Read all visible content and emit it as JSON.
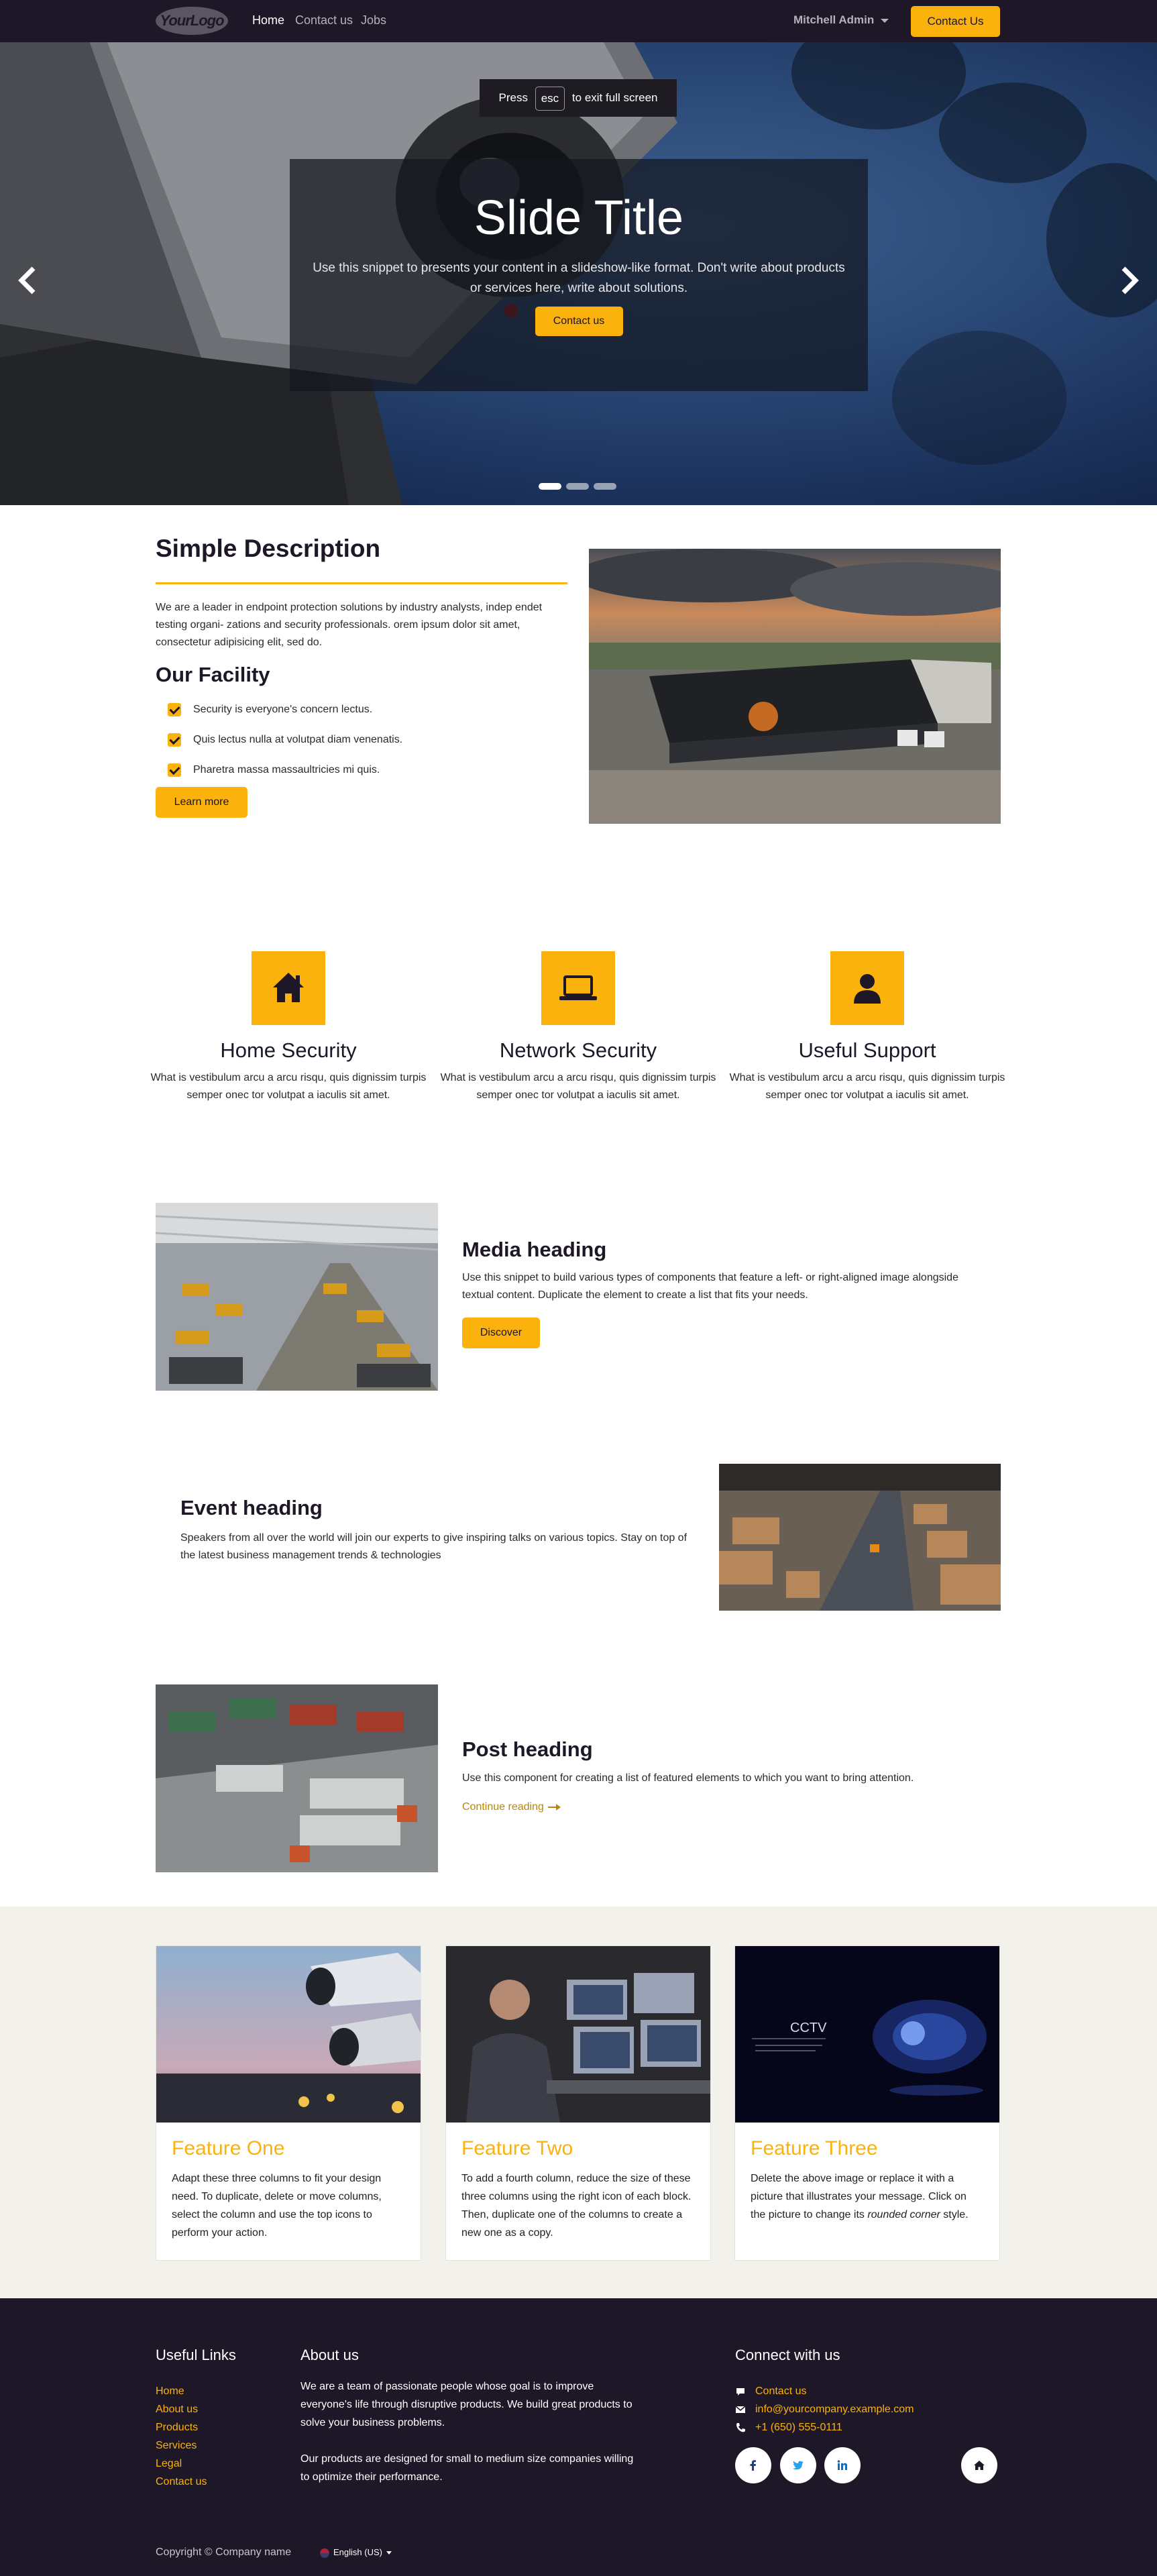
{
  "nav": {
    "logo_text": "YourLogo",
    "links": [
      "Home",
      "Contact us",
      "Jobs"
    ],
    "user": "Mitchell Admin",
    "cta": "Contact Us"
  },
  "hero": {
    "esc_press": "Press",
    "esc_key": "esc",
    "esc_rest": "to exit full screen",
    "title": "Slide Title",
    "text": "Use this snippet to presents your content in a slideshow-like format. Don't write about products or services here, write about solutions.",
    "button": "Contact us",
    "active_slide": 1,
    "slide_count": 3
  },
  "description": {
    "title": "Simple Description",
    "text": "We are a leader in endpoint protection solutions by industry analysts, indep endet testing organi- zations and security professionals. orem ipsum dolor sit amet, consectetur adipisicing elit, sed do.",
    "facility_title": "Our Facility",
    "items": [
      "Security is everyone's concern lectus.",
      "Quis lectus nulla at volutpat diam venenatis.",
      "Pharetra massa massaultricies mi quis."
    ],
    "button": "Learn more"
  },
  "features": [
    {
      "icon": "home-icon",
      "title": "Home Security",
      "text": "What is vestibulum arcu a arcu risqu, quis dignissim turpis semper onec tor volutpat a iaculis sit amet."
    },
    {
      "icon": "laptop-icon",
      "title": "Network Security",
      "text": "What is vestibulum arcu a arcu risqu, quis dignissim turpis semper onec tor volutpat a iaculis sit amet."
    },
    {
      "icon": "user-icon",
      "title": "Useful Support",
      "text": "What is vestibulum arcu a arcu risqu, quis dignissim turpis semper onec tor volutpat a iaculis sit amet."
    }
  ],
  "media": {
    "heading": "Media heading",
    "text": "Use this snippet to build various types of components that feature a left- or right-aligned image alongside textual content. Duplicate the element to create a list that fits your needs.",
    "button": "Discover"
  },
  "event": {
    "heading": "Event heading",
    "text": "Speakers from all over the world will join our experts to give inspiring talks on various topics. Stay on top of the latest business management trends & technologies"
  },
  "post": {
    "heading": "Post heading",
    "text": "Use this component for creating a list of featured elements to which you want to bring attention.",
    "link": "Continue reading"
  },
  "cards": [
    {
      "title": "Feature One",
      "text": "Adapt these three columns to fit your design need. To duplicate, delete or move columns, select the column and use the top icons to perform your action."
    },
    {
      "title": "Feature Two",
      "text": "To add a fourth column, reduce the size of these three columns using the right icon of each block. Then, duplicate one of the columns to create a new one as a copy."
    },
    {
      "title": "Feature Three",
      "text_before": "Delete the above image or replace it with a picture that illustrates your message. Click on the picture to change its ",
      "text_em": "rounded corner",
      "text_after": " style.",
      "image_label": "CCTV"
    }
  ],
  "footer": {
    "links_title": "Useful Links",
    "links": [
      "Home",
      "About us",
      "Products",
      "Services",
      "Legal",
      "Contact us"
    ],
    "about_title": "About us",
    "about_p1": "We are a team of passionate people whose goal is to improve everyone's life through disruptive products. We build great products to solve your business problems.",
    "about_p2": "Our products are designed for small to medium size companies willing to optimize their performance.",
    "connect_title": "Connect with us",
    "contact": [
      {
        "icon": "comment-icon",
        "text": "Contact us"
      },
      {
        "icon": "envelope-icon",
        "text": "info@yourcompany.example.com"
      },
      {
        "icon": "phone-icon",
        "text": "+1 (650) 555-0111"
      }
    ],
    "social": [
      "facebook-icon",
      "twitter-icon",
      "linkedin-icon",
      "home-icon"
    ],
    "copyright": "Copyright © Company name",
    "language": "English (US)"
  },
  "colors": {
    "accent": "#fbb20d",
    "dark": "#1d1727",
    "section_bg": "#f2f1ec"
  }
}
